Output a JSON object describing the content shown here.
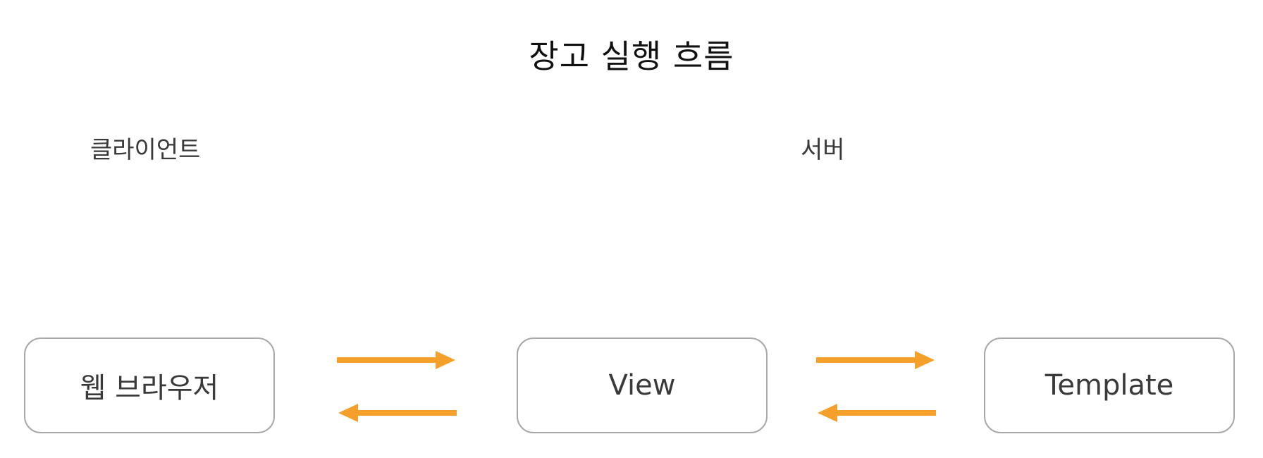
{
  "diagram": {
    "title": "장고 실행 흐름",
    "labels": {
      "client": "클라이언트",
      "server": "서버"
    },
    "nodes": {
      "browser": "웹 브라우저",
      "view": "View",
      "template": "Template"
    },
    "colors": {
      "arrow": "#F5A02A",
      "box_border": "#A8A8A8",
      "text": "#3A3A3A"
    }
  }
}
